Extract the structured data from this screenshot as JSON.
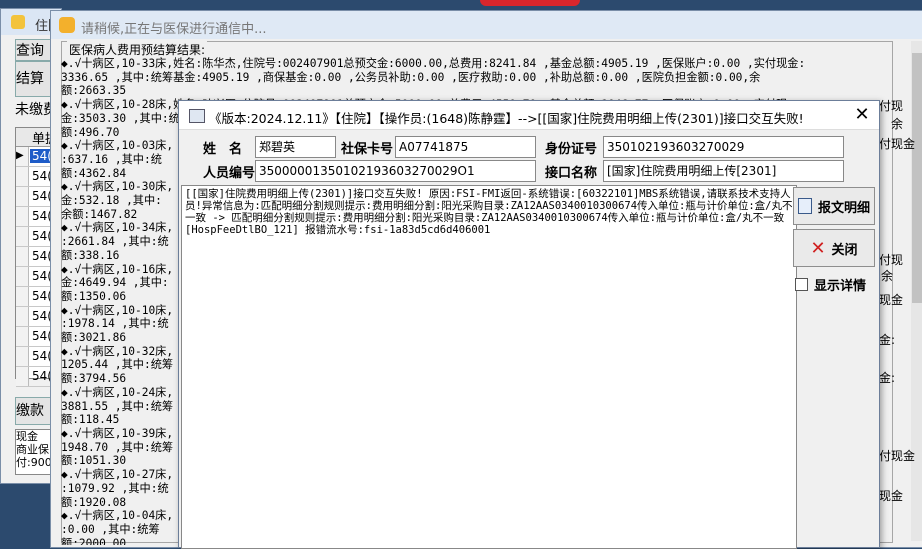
{
  "back_window": {
    "title": "住院",
    "tab_query": "查询",
    "tab_settle": "结算",
    "unpaid_label": "未缴费",
    "col_header": "单据",
    "row_values": [
      "54(",
      "54(",
      "54(",
      "54(",
      "54(",
      "54(",
      "54(",
      "54(",
      "54(",
      "54(",
      "54(",
      "54("
    ],
    "btn_pay": "缴款",
    "footer_lines": [
      "现金",
      "商业保",
      "付:900"
    ]
  },
  "main_window": {
    "title": "请稍候,正在与医保进行通信中...",
    "group_label": "医保病人费用预结算结果:",
    "lines": [
      "◆.√十病区,10-33床,姓名:陈华杰,住院号:002407901总预交金:6000.00,总费用:8241.84 ,基金总额:4905.19 ,医保账户:0.00 ,实付现金:",
      "3336.65 ,其中:统筹基金:4905.19 ,商保基金:0.00 ,公务员补助:0.00 ,医疗救助:0.00 ,补助总额:0.00 ,医院负担金额:0.00,余",
      "额:2663.35",
      "◆.√十病区,10-28床,姓名:叶兴原,住院号:002407901总预交金:5000.00,总费用:4550.70 ,基金总额:1046.77 ,医保账户:0.00 ,实付现",
      "金:3503.30 ,其中:统筹基金:1046.77 ,商保基金:0.00 ,公务员补助:0.00 ,医疗救助:0.00 ,补助总额:0.00 ,医院负担金额:0.00,余",
      "额:496.70",
      "◆.√十病区,10-03床,",
      ":637.16 ,其中:统",
      "额:4362.84",
      "◆.√十病区,10-30床,",
      "金:532.18 ,其中:",
      "余额:1467.82",
      "◆.√十病区,10-34床,",
      ":2661.84 ,其中:统",
      "额:338.16",
      "◆.√十病区,10-16床,",
      "金:4649.94 ,其中:",
      "额:1350.06",
      "◆.√十病区,10-10床,",
      ":1978.14 ,其中:统",
      "额:3021.86",
      "◆.√十病区,10-32床,",
      "1205.44 ,其中:统筹",
      "额:3794.56",
      "◆.√十病区,10-24床,",
      "3881.55 ,其中:统筹",
      "额:118.45",
      "◆.√十病区,10-39床,",
      "1948.70 ,其中:统筹",
      "额:1051.30",
      "◆.√十病区,10-27床,",
      ":1079.92 ,其中:统",
      "额:1920.08",
      "◆.√十病区,10-04床,",
      ":0.00 ,其中:统筹",
      "额:2000.00"
    ],
    "right_fragments": [
      "付现",
      "余",
      "付现金",
      "付现",
      "余",
      "现金",
      "金:",
      "金:",
      "付现金",
      "现金"
    ]
  },
  "dialog": {
    "title": "《版本:2024.12.11》【住院】【操作员:(1648)陈静霆】-->[[国家]住院费用明细上传(2301)]接口交互失败!",
    "close_glyph": "✕",
    "name_label": "姓　名",
    "name_value": "郑碧英",
    "card_label": "社保卡号",
    "card_value": "A07741875",
    "id_label": "身份证号",
    "id_value": "350102193603270029",
    "staff_label": "人员编号",
    "staff_value": "35000001350102193603270029O1",
    "iface_label": "接口名称",
    "iface_value": "[国家]住院费用明细上传[2301]",
    "message": "[[国家]住院费用明细上传(2301)]接口交互失败! 原因:FSI-FMI返回-系统错误:[60322101]MBS系统错误,请联系技术支持人员!异常信息为:匹配明细分割规则提示:费用明细分割:阳光采购目录:ZA12AAS0340010300674传入单位:瓶与计价单位:盒/丸不一致 -> 匹配明细分割规则提示:费用明细分割:阳光采购目录:ZA12AAS0340010300674传入单位:瓶与计价单位:盒/丸不一致[HospFeeDtlBO_121] 报错流水号:fsi-1a83d5cd6d406001",
    "btn_detail": "报文明细",
    "btn_close": "关闭",
    "chk_detail": "显示详情"
  },
  "colors": {
    "accent_red": "#d8262c",
    "selection": "#1e5cc8",
    "desktop": "#2c4a6e"
  }
}
